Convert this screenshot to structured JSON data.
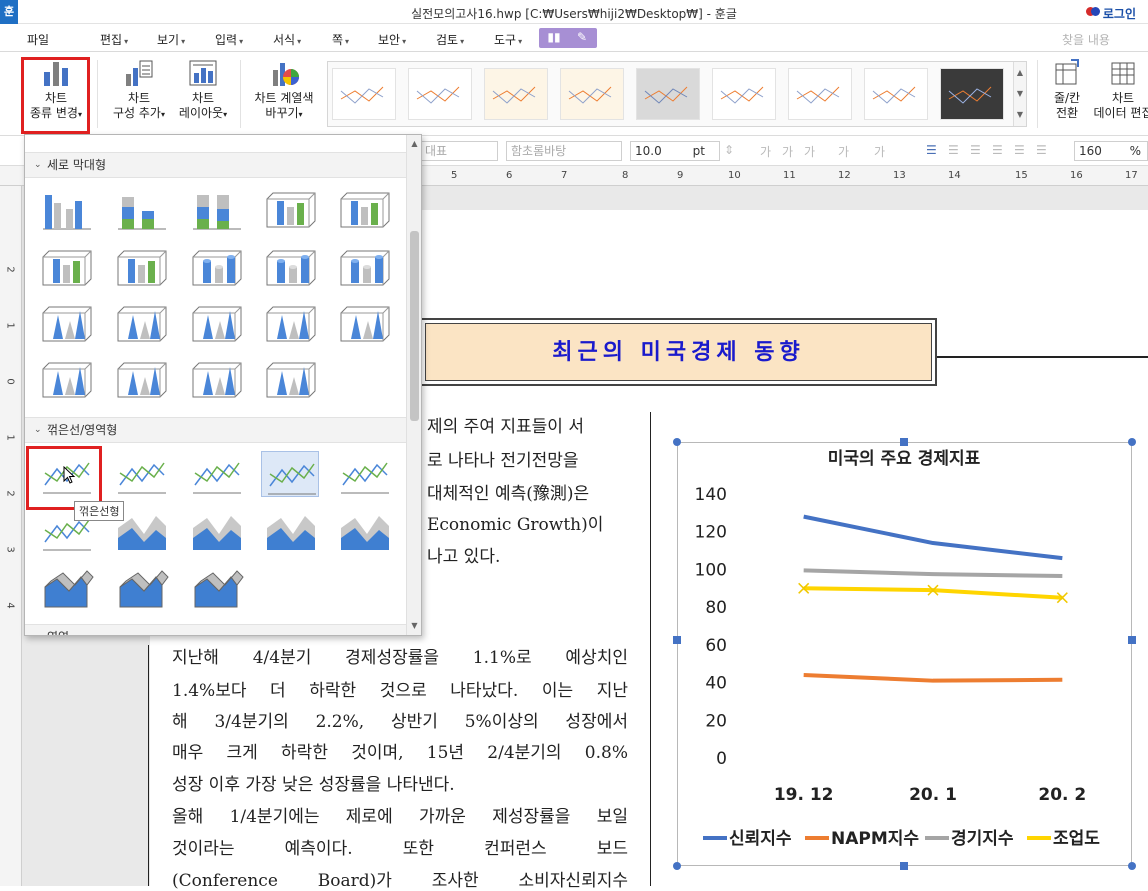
{
  "window": {
    "title": "실전모의고사16.hwp [C:₩Users₩hiji2₩Desktop₩] - 훈글",
    "app_icon_label": "훈",
    "login_label": "로그인"
  },
  "menu": {
    "items": [
      "파일",
      "편집",
      "보기",
      "입력",
      "서식",
      "쪽",
      "보안",
      "검토",
      "도구"
    ],
    "find_placeholder": "찾을 내용"
  },
  "ribbon": {
    "chart_type_change": [
      "차트",
      "종류 변경"
    ],
    "chart_add_element": [
      "차트",
      "구성 추가"
    ],
    "chart_layout": [
      "차트",
      "레이아웃"
    ],
    "chart_color_change": [
      "차트 계열색",
      "바꾸기"
    ],
    "row_col_switch": [
      "줄/칸",
      "전환"
    ],
    "chart_data_edit": [
      "차트",
      "데이터 편집"
    ]
  },
  "format_toolbar": {
    "style_value": "대표",
    "font_value": "함초롬바탕",
    "size_value": "10.0",
    "size_unit": "pt",
    "zoom_value": "160",
    "zoom_unit": "%"
  },
  "ruler": {
    "h_numbers": [
      "5",
      "6",
      "7",
      "8",
      "9",
      "10",
      "11",
      "12",
      "13",
      "14",
      "15",
      "16",
      "17"
    ],
    "v_numbers": [
      "2",
      "1",
      "0",
      "1",
      "2",
      "3",
      "4"
    ]
  },
  "dropdown": {
    "section_column": "세로 막대형",
    "section_line": "꺾은선/영역형",
    "section_next": "영역",
    "tooltip": "꺾은선형"
  },
  "document": {
    "title": "최근의 미국경제 동향",
    "top_lines": [
      "제의 주여 지표들이 서",
      "로 나타나 전기전망을",
      "대체적인 예측(豫測)은",
      "Economic Growth)이",
      "나고 있다."
    ],
    "body_lines": [
      "지난해 4/4분기 경제성장률을 1.1%로 예상치인",
      "1.4%보다 더 하락한 것으로 나타났다. 이는 지난",
      "해 3/4분기의 2.2%, 상반기 5%이상의 성장에서",
      "매우 크게 하락한 것이며, 15년 2/4분기의 0.8%",
      "성장 이후 가장 낮은 성장률을 나타낸다.",
      "올해 1/4분기에는 제로에 가까운 제성장률을 보일",
      "것이라는 예측이다. 또한 컨퍼런스 보드",
      "(Conference Board)가 조사한 소비자신뢰지수"
    ]
  },
  "chart_data": {
    "type": "line",
    "title": "미국의 주요 경제지표",
    "categories": [
      "19. 12",
      "20. 1",
      "20. 2"
    ],
    "ylim": [
      0,
      140
    ],
    "yticks": [
      "0",
      "20",
      "40",
      "60",
      "80",
      "100",
      "120",
      "140"
    ],
    "grid": false,
    "legend_position": "bottom",
    "series": [
      {
        "name": "신뢰지수",
        "values": [
          128,
          114,
          106
        ],
        "color": "#4472c4"
      },
      {
        "name": "NAPM지수",
        "values": [
          44,
          41,
          41.5
        ],
        "color": "#ed7d31"
      },
      {
        "name": "경기지수",
        "values": [
          99.5,
          97.5,
          96.5
        ],
        "color": "#a5a5a5"
      },
      {
        "name": "조업도",
        "values": [
          90,
          89,
          85
        ],
        "color": "#ffd500"
      }
    ]
  }
}
